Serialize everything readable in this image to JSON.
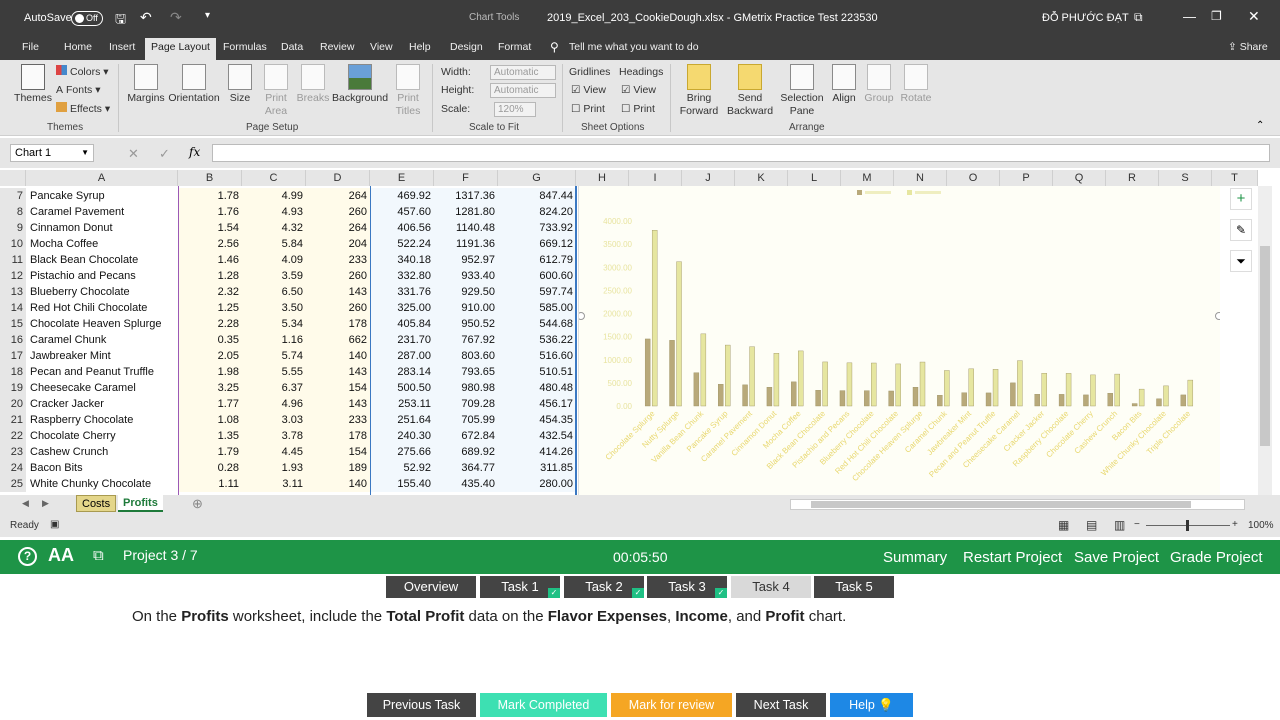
{
  "title_bar": {
    "autosave_label": "AutoSave",
    "autosave_state": "Off",
    "chart_tools": "Chart Tools",
    "file_title": "2019_Excel_203_CookieDough.xlsx - GMetrix Practice Test 223530",
    "user": "ĐỖ PHƯỚC ĐẠT"
  },
  "ribbon_tabs": [
    "File",
    "Home",
    "Insert",
    "Page Layout",
    "Formulas",
    "Data",
    "Review",
    "View",
    "Help",
    "Design",
    "Format"
  ],
  "tell_me": "Tell me what you want to do",
  "share": "Share",
  "ribbon": {
    "themes": {
      "themes": "Themes",
      "colors": "Colors",
      "fonts": "Fonts",
      "effects": "Effects",
      "group": "Themes"
    },
    "page_setup": {
      "margins": "Margins",
      "orientation": "Orientation",
      "size": "Size",
      "print_area": "Print Area",
      "breaks": "Breaks",
      "background": "Background",
      "print_titles": "Print Titles",
      "group": "Page Setup"
    },
    "scale": {
      "width_label": "Width:",
      "width_value": "Automatic",
      "height_label": "Height:",
      "height_value": "Automatic",
      "scale_label": "Scale:",
      "scale_value": "120%",
      "group": "Scale to Fit"
    },
    "sheet_options": {
      "gridlines": "Gridlines",
      "headings": "Headings",
      "view": "View",
      "print": "Print",
      "group": "Sheet Options"
    },
    "arrange": {
      "bring_forward": "Bring Forward",
      "send_backward": "Send Backward",
      "selection_pane": "Selection Pane",
      "align": "Align",
      "group_btn": "Group",
      "rotate": "Rotate",
      "group": "Arrange"
    }
  },
  "name_box": "Chart 1",
  "columns": [
    "A",
    "B",
    "C",
    "D",
    "E",
    "F",
    "G",
    "H",
    "I",
    "J",
    "K",
    "L",
    "M",
    "N",
    "O",
    "P",
    "Q",
    "R",
    "S",
    "T"
  ],
  "rows": [
    {
      "n": "7",
      "name": "Pancake Syrup",
      "b": "1.78",
      "c": "4.99",
      "d": "264",
      "e": "469.92",
      "f": "1317.36",
      "g": "847.44"
    },
    {
      "n": "8",
      "name": "Caramel Pavement",
      "b": "1.76",
      "c": "4.93",
      "d": "260",
      "e": "457.60",
      "f": "1281.80",
      "g": "824.20"
    },
    {
      "n": "9",
      "name": "Cinnamon Donut",
      "b": "1.54",
      "c": "4.32",
      "d": "264",
      "e": "406.56",
      "f": "1140.48",
      "g": "733.92"
    },
    {
      "n": "10",
      "name": "Mocha Coffee",
      "b": "2.56",
      "c": "5.84",
      "d": "204",
      "e": "522.24",
      "f": "1191.36",
      "g": "669.12"
    },
    {
      "n": "11",
      "name": "Black Bean Chocolate",
      "b": "1.46",
      "c": "4.09",
      "d": "233",
      "e": "340.18",
      "f": "952.97",
      "g": "612.79"
    },
    {
      "n": "12",
      "name": "Pistachio and Pecans",
      "b": "1.28",
      "c": "3.59",
      "d": "260",
      "e": "332.80",
      "f": "933.40",
      "g": "600.60"
    },
    {
      "n": "13",
      "name": "Blueberry Chocolate",
      "b": "2.32",
      "c": "6.50",
      "d": "143",
      "e": "331.76",
      "f": "929.50",
      "g": "597.74"
    },
    {
      "n": "14",
      "name": "Red Hot Chili Chocolate",
      "b": "1.25",
      "c": "3.50",
      "d": "260",
      "e": "325.00",
      "f": "910.00",
      "g": "585.00"
    },
    {
      "n": "15",
      "name": "Chocolate Heaven Splurge",
      "b": "2.28",
      "c": "5.34",
      "d": "178",
      "e": "405.84",
      "f": "950.52",
      "g": "544.68"
    },
    {
      "n": "16",
      "name": "Caramel Chunk",
      "b": "0.35",
      "c": "1.16",
      "d": "662",
      "e": "231.70",
      "f": "767.92",
      "g": "536.22"
    },
    {
      "n": "17",
      "name": "Jawbreaker Mint",
      "b": "2.05",
      "c": "5.74",
      "d": "140",
      "e": "287.00",
      "f": "803.60",
      "g": "516.60"
    },
    {
      "n": "18",
      "name": "Pecan and Peanut Truffle",
      "b": "1.98",
      "c": "5.55",
      "d": "143",
      "e": "283.14",
      "f": "793.65",
      "g": "510.51"
    },
    {
      "n": "19",
      "name": "Cheesecake Caramel",
      "b": "3.25",
      "c": "6.37",
      "d": "154",
      "e": "500.50",
      "f": "980.98",
      "g": "480.48"
    },
    {
      "n": "20",
      "name": "Cracker Jacker",
      "b": "1.77",
      "c": "4.96",
      "d": "143",
      "e": "253.11",
      "f": "709.28",
      "g": "456.17"
    },
    {
      "n": "21",
      "name": "Raspberry Chocolate",
      "b": "1.08",
      "c": "3.03",
      "d": "233",
      "e": "251.64",
      "f": "705.99",
      "g": "454.35"
    },
    {
      "n": "22",
      "name": "Chocolate Cherry",
      "b": "1.35",
      "c": "3.78",
      "d": "178",
      "e": "240.30",
      "f": "672.84",
      "g": "432.54"
    },
    {
      "n": "23",
      "name": "Cashew Crunch",
      "b": "1.79",
      "c": "4.45",
      "d": "154",
      "e": "275.66",
      "f": "689.92",
      "g": "414.26"
    },
    {
      "n": "24",
      "name": "Bacon Bits",
      "b": "0.28",
      "c": "1.93",
      "d": "189",
      "e": "52.92",
      "f": "364.77",
      "g": "311.85"
    },
    {
      "n": "25",
      "name": "White Chunky Chocolate",
      "b": "1.11",
      "c": "3.11",
      "d": "140",
      "e": "155.40",
      "f": "435.40",
      "g": "280.00"
    }
  ],
  "chart_data": {
    "type": "bar",
    "categories": [
      "Chocolate Splurge",
      "Nutty Splurge",
      "Vanilla Bean Chunk",
      "Pancake Syrup",
      "Caramel Pavement",
      "Cinnamon Donut",
      "Mocha Coffee",
      "Black Bean Chocolate",
      "Pistachio and Pecans",
      "Blueberry Chocolate",
      "Red Hot Chili Chocolate",
      "Chocolate Heaven Splurge",
      "Caramel Chunk",
      "Jawbreaker Mint",
      "Pecan and Peanut Truffle",
      "Cheesecake Caramel",
      "Cracker Jacker",
      "Raspberry Chocolate",
      "Chocolate Cherry",
      "Cashew Crunch",
      "Bacon Bits",
      "White Chunky Chocolate",
      "Triple Chocolate"
    ],
    "series": [
      {
        "values": [
          1450,
          1420,
          720,
          469.92,
          457.6,
          406.56,
          522.24,
          340.18,
          332.8,
          331.76,
          325,
          405.84,
          231.7,
          287,
          283.14,
          500.5,
          253.11,
          251.64,
          240.3,
          275.66,
          52.92,
          155.4,
          240
        ],
        "color": "#b8a97a"
      },
      {
        "values": [
          3800,
          3120,
          1560,
          1317.36,
          1281.8,
          1140.48,
          1191.36,
          952.97,
          933.4,
          929.5,
          910,
          950.52,
          767.92,
          803.6,
          793.65,
          980.98,
          709.28,
          705.99,
          672.84,
          689.92,
          364.77,
          435.4,
          560
        ],
        "color": "#e6e6a0"
      }
    ],
    "ytick_labels": [
      "0.00",
      "500.00",
      "1000.00",
      "1500.00",
      "2000.00",
      "2500.00",
      "3000.00",
      "3500.00",
      "4000.00"
    ],
    "ylim": [
      0,
      4000
    ],
    "legend_position": "top"
  },
  "sheet_tabs": [
    "Costs",
    "Profits"
  ],
  "status": {
    "ready": "Ready",
    "zoom": "100%"
  },
  "gmetrix": {
    "project": "Project 3 / 7",
    "timer": "00:05:50",
    "summary": "Summary",
    "restart": "Restart Project",
    "save": "Save Project",
    "grade": "Grade Project",
    "tasks": [
      "Overview",
      "Task 1",
      "Task 2",
      "Task 3",
      "Task 4",
      "Task 5"
    ],
    "instruction": {
      "t1": "On the ",
      "b1": "Profits",
      "t2": " worksheet, include the ",
      "b2": "Total Profit",
      "t3": " data on the ",
      "b3": "Flavor Expenses",
      "t4": ", ",
      "b4": "Income",
      "t5": ", and ",
      "b5": "Profit",
      "t6": " chart."
    },
    "footer": {
      "prev": "Previous Task",
      "complete": "Mark Completed",
      "review": "Mark for review",
      "next": "Next Task",
      "help": "Help"
    }
  }
}
